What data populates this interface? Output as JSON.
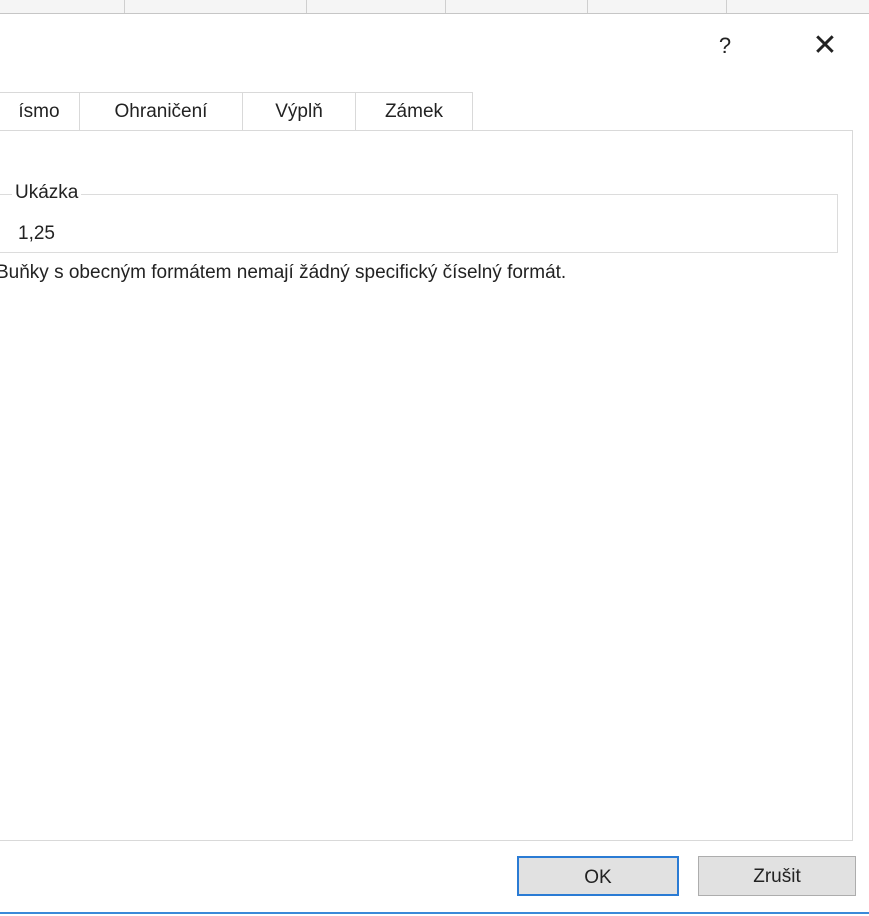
{
  "dialog": {
    "help_label": "?",
    "close_label": "✕"
  },
  "tabs": [
    {
      "label": "ísmo"
    },
    {
      "label": "Ohraničení"
    },
    {
      "label": "Výplň"
    },
    {
      "label": "Zámek"
    }
  ],
  "sample": {
    "title": "Ukázka",
    "value": "1,25"
  },
  "description": "Buňky s obecným formátem nemají žádný specifický číselný formát.",
  "buttons": {
    "ok_label": "OK",
    "cancel_label": "Zrušit"
  },
  "colors": {
    "accent": "#2a7bd4",
    "button_bg": "#e1e1e1"
  }
}
